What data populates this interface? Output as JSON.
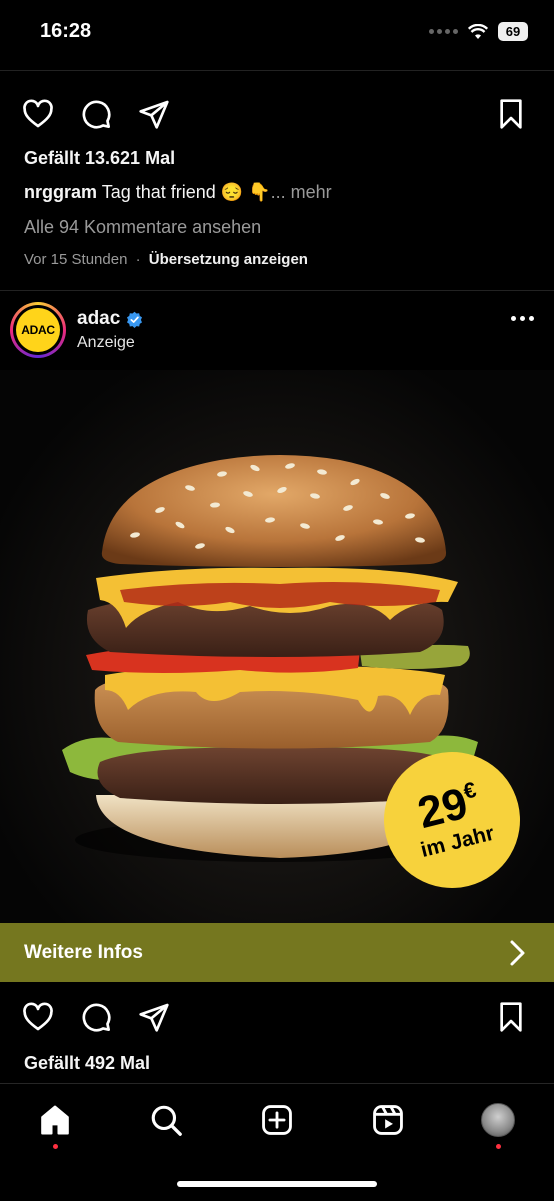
{
  "status_bar": {
    "time": "16:28",
    "battery": "69"
  },
  "post1": {
    "likes": "Gefällt 13.621 Mal",
    "caption_user": "nrggram",
    "caption_text": "Tag that friend 😔 👇",
    "caption_more": "... mehr",
    "comments_link": "Alle 94 Kommentare ansehen",
    "time_ago": "Vor 15 Stunden",
    "separator": "·",
    "translate": "Übersetzung anzeigen"
  },
  "ad": {
    "account_name": "adac",
    "logo_text": "ADAC",
    "sponsored": "Anzeige",
    "price_value": "29",
    "price_currency": "€",
    "price_period": "im Jahr",
    "cta_label": "Weitere Infos",
    "likes": "Gefällt 492 Mal"
  },
  "colors": {
    "cta_background": "#75771f",
    "badge_yellow": "#f7d23c",
    "verified_blue": "#3897f0",
    "notification_red": "#ff3040"
  },
  "icons": {
    "post_actions": [
      "heart-icon",
      "comment-icon",
      "share-icon",
      "bookmark-icon"
    ],
    "tabbar": [
      "home-icon",
      "search-icon",
      "create-icon",
      "reels-icon",
      "profile-icon"
    ]
  }
}
